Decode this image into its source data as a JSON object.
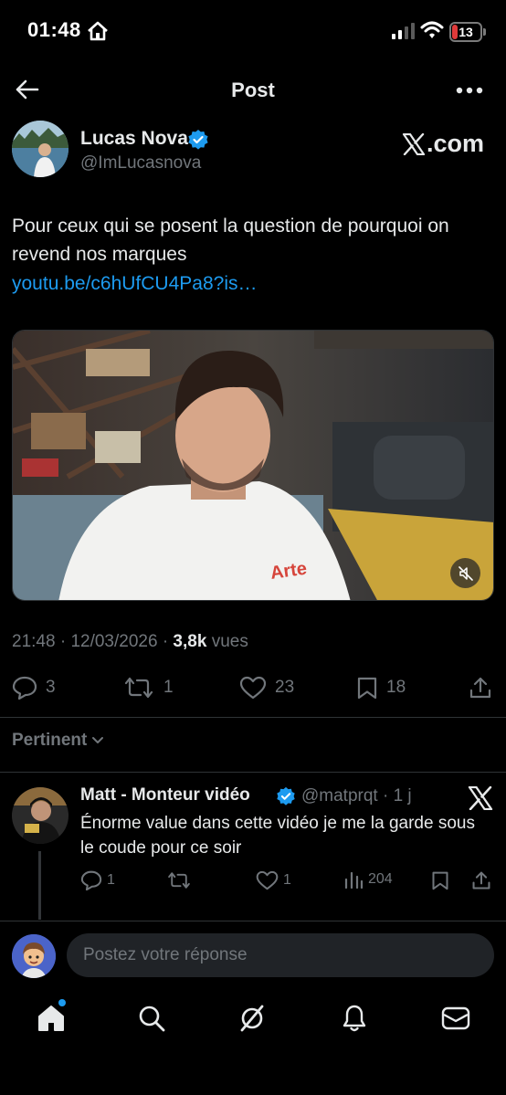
{
  "status_bar": {
    "time": "01:48",
    "battery": "13"
  },
  "header": {
    "title": "Post"
  },
  "post": {
    "author_name": "Lucas Nova",
    "author_handle": "@ImLucasnova",
    "source": ".com",
    "text": "Pour ceux qui se posent la question de pourquoi on revend nos marques",
    "link": "youtu.be/c6hUfCU4Pa8?is…",
    "video_shirt_text": "Arte",
    "time": "21:48",
    "date": "12/03/2026",
    "views_count": "3,8k",
    "views_label": "vues",
    "replies": "3",
    "reposts": "1",
    "likes": "23",
    "bookmarks": "18"
  },
  "sort_label": "Pertinent",
  "reply": {
    "author_name": "Matt - Monteur vidéo",
    "author_handle": "@matprqt · 1 j",
    "text": "Énorme value dans cette vidéo je me la garde sous le coude pour ce soir",
    "replies": "1",
    "likes": "1",
    "views": "204"
  },
  "composer": {
    "placeholder": "Postez votre réponse"
  },
  "colors": {
    "accent": "#1d9bf0",
    "muted": "#71767b",
    "text": "#e7e9ea",
    "background": "#000000"
  }
}
